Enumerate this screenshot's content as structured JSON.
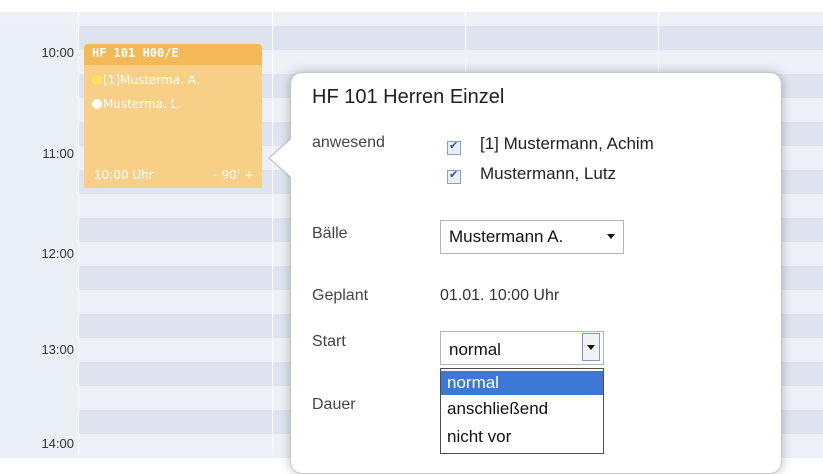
{
  "calendar": {
    "times": [
      "10:00",
      "11:00",
      "12:00",
      "13:00",
      "14:00"
    ],
    "event": {
      "title": "HF 101 H00/E",
      "players": [
        {
          "name": "[1]Musterma. A.",
          "dot_color": "#ffe55a"
        },
        {
          "name": "Musterma. L.",
          "dot_color": "#ffffff"
        }
      ],
      "start": "10:00 Uhr",
      "duration": "- 90' +"
    }
  },
  "popup": {
    "title": "HF 101 Herren Einzel",
    "attendance_label": "anwesend",
    "attendees": [
      {
        "name": "[1] Mustermann, Achim",
        "checked": true
      },
      {
        "name": "Mustermann, Lutz",
        "checked": true
      }
    ],
    "balls_label": "Bälle",
    "balls_value": "Mustermann A.",
    "planned_label": "Geplant",
    "planned_value": "01.01. 10:00 Uhr",
    "start_label": "Start",
    "start_value": "normal",
    "start_options": [
      "normal",
      "anschließend",
      "nicht vor"
    ],
    "duration_label": "Dauer"
  },
  "colors": {
    "event_bg": "#f8cf86",
    "event_header": "#f3b957",
    "highlight": "#3d78d6"
  }
}
